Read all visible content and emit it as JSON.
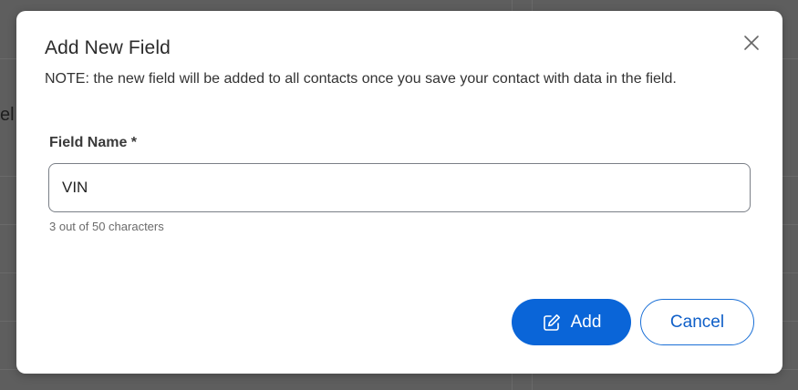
{
  "background": {
    "fragment_text": "el"
  },
  "modal": {
    "title": "Add New Field",
    "note": "NOTE: the new field will be added to all contacts once you save your contact with data in the field.",
    "field": {
      "label": "Field Name *",
      "value": "VIN",
      "counter": "3 out of 50 characters"
    },
    "buttons": {
      "add_label": "Add",
      "cancel_label": "Cancel"
    },
    "icons": {
      "close": "close-icon",
      "add": "edit-pencil-icon"
    }
  },
  "colors": {
    "primary": "#0a65d8",
    "overlay": "#5f5f5f",
    "input_border": "#7a7f87"
  }
}
